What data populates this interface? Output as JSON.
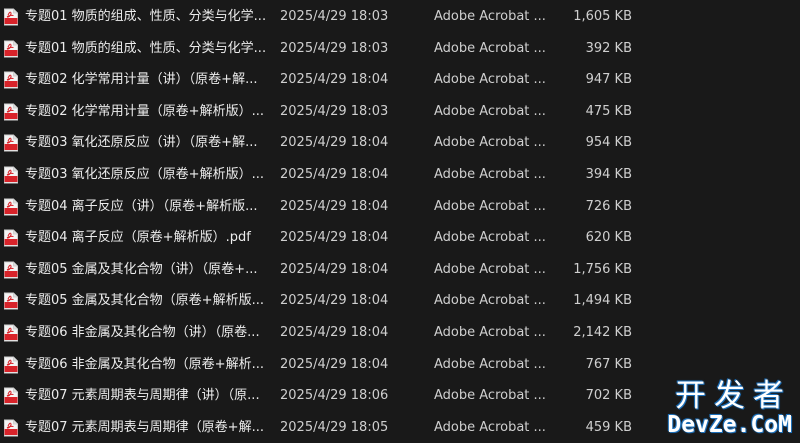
{
  "file_icon": "pdf-file-icon",
  "files": [
    {
      "name": "专题01 物质的组成、性质、分类与化学...",
      "date": "2025/4/29 18:03",
      "type": "Adobe Acrobat ...",
      "size": "1,605 KB"
    },
    {
      "name": "专题01 物质的组成、性质、分类与化学...",
      "date": "2025/4/29 18:03",
      "type": "Adobe Acrobat ...",
      "size": "392 KB"
    },
    {
      "name": "专题02 化学常用计量（讲）（原卷+解...",
      "date": "2025/4/29 18:04",
      "type": "Adobe Acrobat ...",
      "size": "947 KB"
    },
    {
      "name": "专题02 化学常用计量（原卷+解析版）....",
      "date": "2025/4/29 18:03",
      "type": "Adobe Acrobat ...",
      "size": "475 KB"
    },
    {
      "name": "专题03 氧化还原反应（讲）（原卷+解...",
      "date": "2025/4/29 18:04",
      "type": "Adobe Acrobat ...",
      "size": "954 KB"
    },
    {
      "name": "专题03 氧化还原反应（原卷+解析版）....",
      "date": "2025/4/29 18:04",
      "type": "Adobe Acrobat ...",
      "size": "394 KB"
    },
    {
      "name": "专题04 离子反应（讲）（原卷+解析版...",
      "date": "2025/4/29 18:04",
      "type": "Adobe Acrobat ...",
      "size": "726 KB"
    },
    {
      "name": "专题04 离子反应（原卷+解析版）.pdf",
      "date": "2025/4/29 18:04",
      "type": "Adobe Acrobat ...",
      "size": "620 KB"
    },
    {
      "name": "专题05 金属及其化合物（讲）（原卷+...",
      "date": "2025/4/29 18:04",
      "type": "Adobe Acrobat ...",
      "size": "1,756 KB"
    },
    {
      "name": "专题05 金属及其化合物（原卷+解析版...",
      "date": "2025/4/29 18:04",
      "type": "Adobe Acrobat ...",
      "size": "1,494 KB"
    },
    {
      "name": "专题06 非金属及其化合物（讲）（原卷...",
      "date": "2025/4/29 18:04",
      "type": "Adobe Acrobat ...",
      "size": "2,142 KB"
    },
    {
      "name": "专题06 非金属及其化合物（原卷+解析...",
      "date": "2025/4/29 18:04",
      "type": "Adobe Acrobat ...",
      "size": "767 KB"
    },
    {
      "name": "专题07 元素周期表与周期律（讲）（原...",
      "date": "2025/4/29 18:06",
      "type": "Adobe Acrobat ...",
      "size": "702 KB"
    },
    {
      "name": "专题07 元素周期表与周期律（原卷+解...",
      "date": "2025/4/29 18:05",
      "type": "Adobe Acrobat ...",
      "size": "459 KB"
    }
  ],
  "watermark": {
    "cn": "开发者",
    "en": "DevZe.CoM"
  }
}
